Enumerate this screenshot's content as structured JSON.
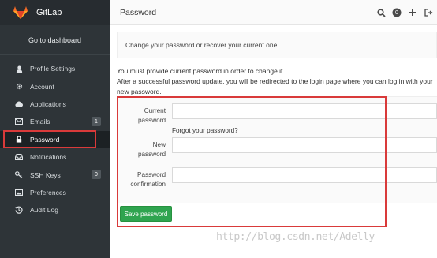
{
  "sidebar": {
    "brand": "GitLab",
    "dashboard": "Go to dashboard",
    "items": [
      {
        "label": "Profile Settings",
        "icon": "user-icon"
      },
      {
        "label": "Account",
        "icon": "gear-icon"
      },
      {
        "label": "Applications",
        "icon": "cloud-icon"
      },
      {
        "label": "Emails",
        "icon": "envelope-icon",
        "count": "1"
      },
      {
        "label": "Password",
        "icon": "lock-icon",
        "active": true
      },
      {
        "label": "Notifications",
        "icon": "inbox-icon"
      },
      {
        "label": "SSH Keys",
        "icon": "key-icon",
        "count": "0"
      },
      {
        "label": "Preferences",
        "icon": "image-icon"
      },
      {
        "label": "Audit Log",
        "icon": "history-icon"
      }
    ]
  },
  "header": {
    "title": "Password",
    "badge": "0"
  },
  "main": {
    "info": "Change your password or recover your current one.",
    "note_1": "You must provide current password in order to change it.",
    "note_2": "After a successful password update, you will be redirected to the login page where you can log in with your new password.",
    "form": {
      "current_label_1": "Current",
      "current_label_2": "password",
      "forgot": "Forgot your password?",
      "new_label_1": "New",
      "new_label_2": "password",
      "confirm_label_1": "Password",
      "confirm_label_2": "confirmation",
      "save": "Save password"
    }
  },
  "watermark": "http://blog.csdn.net/Adelly",
  "colors": {
    "sidebar_bg": "#2e3438",
    "brand_orange": "#fc6d26",
    "save_green": "#2fa44f",
    "highlight_red": "#d93a3a"
  }
}
